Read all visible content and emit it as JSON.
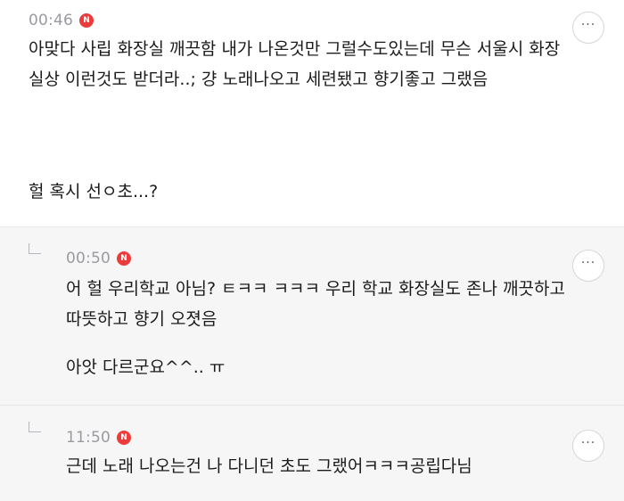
{
  "comments": [
    {
      "time": "00:46",
      "badge": "N",
      "more": "···",
      "text": "아맞다 사립 화장실 깨끗함 내가 나온것만 그럴수도있는데 무슨 서울시 화장실상 이런것도 받더라..; 걍 노래나오고 세련됐고 향기좋고 그랬음",
      "text2": "헐 혹시 선ㅇ초...?"
    },
    {
      "time": "00:50",
      "badge": "N",
      "more": "···",
      "text": "어 헐 우리학교 아님? ㅌㅋㅋ ㅋㅋㅋ 우리 학교 화장실도 존나 깨끗하고 따뜻하고 향기 오졋음",
      "text2": "아앗 다르군요^^.. ㅠ"
    },
    {
      "time": "11:50",
      "badge": "N",
      "more": "···",
      "text": "근데 노래 나오는건 나 다니던 초도 그랬어ㅋㅋㅋ공립다님"
    }
  ],
  "colors": {
    "badge": "#ec3b3b",
    "reply_bg": "#f6f6f7",
    "time": "#9a9aa0"
  },
  "icons": {
    "badge": "new-badge-icon",
    "reply": "reply-arrow-icon",
    "more": "more-options-icon"
  }
}
